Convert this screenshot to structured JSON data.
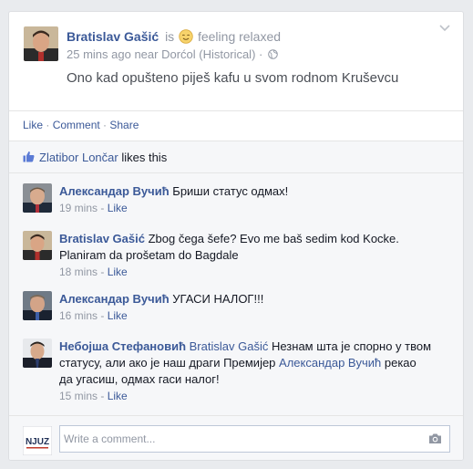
{
  "post": {
    "author": "Bratislav Gašić",
    "is_word": "is",
    "feeling": "feeling relaxed",
    "time": "25 mins ago",
    "near": "near",
    "location": "Dorćol (Historical)",
    "separator": "·",
    "text": "Ono kad opušteno piješ kafu u svom rodnom Kruševcu"
  },
  "actions": {
    "like": "Like",
    "comment": "Comment",
    "share": "Share",
    "dot": " · "
  },
  "likes": {
    "name": "Zlatibor Lončar",
    "suffix": "likes this"
  },
  "comments": [
    {
      "author": "Александар Вучић",
      "text": "Бриши статус одмах!",
      "time": "19 mins",
      "like": "Like"
    },
    {
      "author": "Bratislav Gašić",
      "text": "Zbog čega šefe? Evo me baš sedim kod Kocke. Planiram da prošetam do Bagdale",
      "time": "18 mins",
      "like": "Like"
    },
    {
      "author": "Александар Вучић",
      "text": "УГАСИ НАЛОГ!!!",
      "time": "16 mins",
      "like": "Like"
    },
    {
      "author": "Небојша Стефановић",
      "tag1": "Bratislav Gašić",
      "text_part1": "Незнам шта је спорно у твом статусу, али ако је наш драги Премијер",
      "tag2": "Александар Вучић",
      "text_part2": "рекао да угасиш, одмах гаси налог!",
      "time": "15 mins",
      "like": "Like"
    }
  ],
  "meta_sep": " - ",
  "composer": {
    "placeholder": "Write a comment...",
    "avatar_label": "NJUZ"
  },
  "colors": {
    "link": "#3b5998",
    "muted": "#9197a3",
    "background": "#e9ebee"
  }
}
